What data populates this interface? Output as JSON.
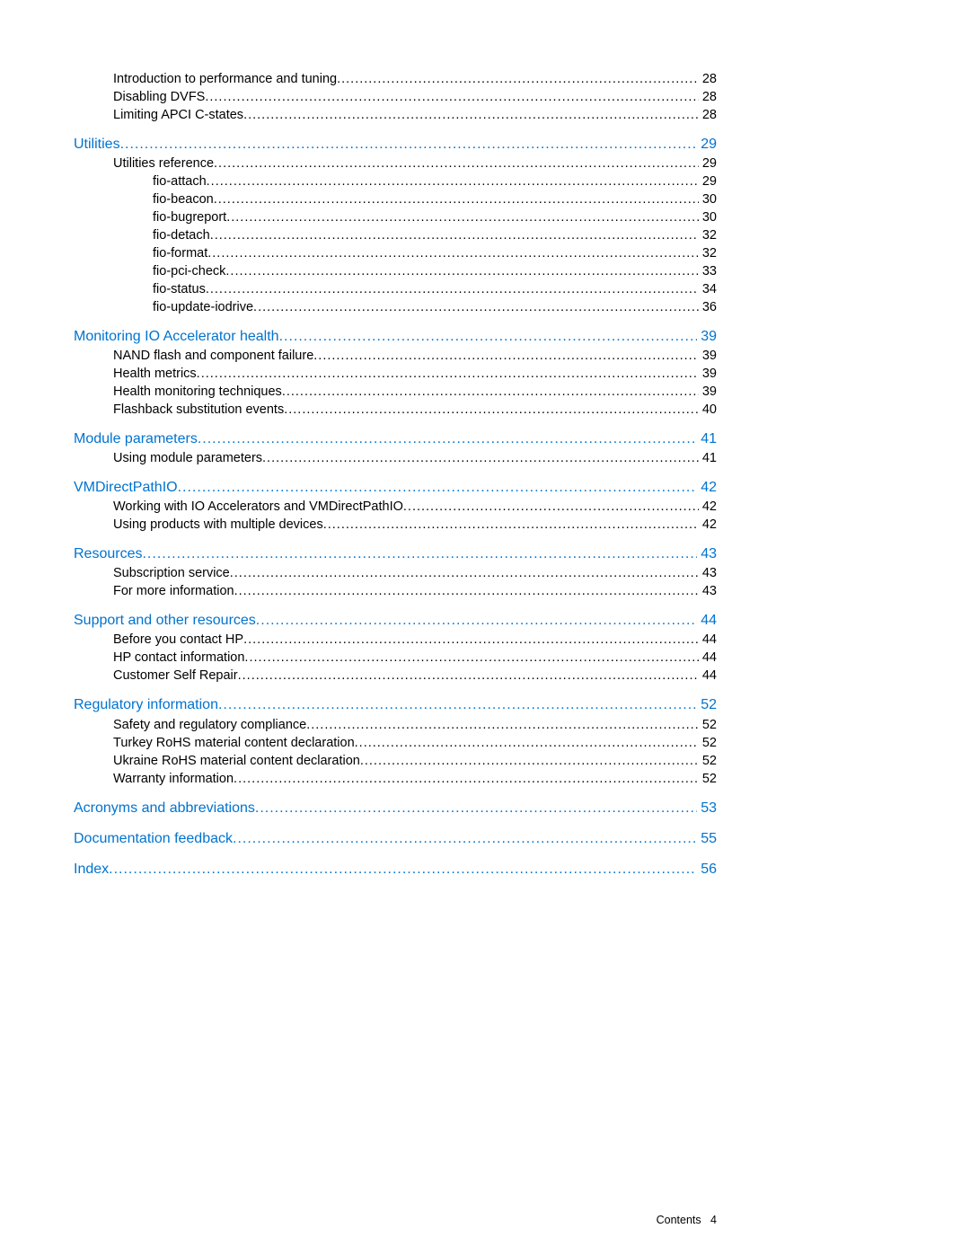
{
  "footer": {
    "label": "Contents",
    "page": "4"
  },
  "toc": [
    {
      "items": [
        {
          "level": 2,
          "label": "Introduction to performance and tuning",
          "page": "28"
        },
        {
          "level": 2,
          "label": "Disabling DVFS",
          "page": "28"
        },
        {
          "level": 2,
          "label": "Limiting APCI C-states",
          "page": "28"
        }
      ]
    },
    {
      "heading": {
        "label": "Utilities",
        "page": "29"
      },
      "items": [
        {
          "level": 2,
          "label": "Utilities reference",
          "page": "29"
        },
        {
          "level": 3,
          "label": "fio-attach",
          "page": "29"
        },
        {
          "level": 3,
          "label": "fio-beacon",
          "page": "30"
        },
        {
          "level": 3,
          "label": "fio-bugreport",
          "page": "30"
        },
        {
          "level": 3,
          "label": "fio-detach",
          "page": "32"
        },
        {
          "level": 3,
          "label": "fio-format",
          "page": "32"
        },
        {
          "level": 3,
          "label": "fio-pci-check",
          "page": "33"
        },
        {
          "level": 3,
          "label": "fio-status",
          "page": "34"
        },
        {
          "level": 3,
          "label": "fio-update-iodrive",
          "page": "36"
        }
      ]
    },
    {
      "heading": {
        "label": "Monitoring IO Accelerator health",
        "page": "39"
      },
      "items": [
        {
          "level": 2,
          "label": "NAND flash and component failure",
          "page": "39"
        },
        {
          "level": 2,
          "label": "Health metrics",
          "page": "39"
        },
        {
          "level": 2,
          "label": "Health monitoring techniques",
          "page": "39"
        },
        {
          "level": 2,
          "label": "Flashback substitution events",
          "page": "40"
        }
      ]
    },
    {
      "heading": {
        "label": "Module parameters",
        "page": "41"
      },
      "items": [
        {
          "level": 2,
          "label": "Using module parameters",
          "page": "41"
        }
      ]
    },
    {
      "heading": {
        "label": "VMDirectPathIO",
        "page": "42"
      },
      "items": [
        {
          "level": 2,
          "label": "Working with IO Accelerators and VMDirectPathIO",
          "page": "42"
        },
        {
          "level": 2,
          "label": "Using products with multiple devices",
          "page": "42"
        }
      ]
    },
    {
      "heading": {
        "label": "Resources",
        "page": "43"
      },
      "items": [
        {
          "level": 2,
          "label": "Subscription service",
          "page": "43"
        },
        {
          "level": 2,
          "label": "For more information",
          "page": "43"
        }
      ]
    },
    {
      "heading": {
        "label": "Support and other resources",
        "page": "44"
      },
      "items": [
        {
          "level": 2,
          "label": "Before you contact HP",
          "page": "44"
        },
        {
          "level": 2,
          "label": "HP contact information",
          "page": "44"
        },
        {
          "level": 2,
          "label": "Customer Self Repair",
          "page": "44"
        }
      ]
    },
    {
      "heading": {
        "label": "Regulatory information",
        "page": "52"
      },
      "items": [
        {
          "level": 2,
          "label": "Safety and regulatory compliance",
          "page": "52"
        },
        {
          "level": 2,
          "label": "Turkey RoHS material content declaration",
          "page": "52"
        },
        {
          "level": 2,
          "label": "Ukraine RoHS material content declaration",
          "page": "52"
        },
        {
          "level": 2,
          "label": "Warranty information",
          "page": "52"
        }
      ]
    },
    {
      "heading": {
        "label": "Acronyms and abbreviations",
        "page": "53"
      },
      "items": []
    },
    {
      "heading": {
        "label": "Documentation feedback",
        "page": "55"
      },
      "items": []
    },
    {
      "heading": {
        "label": "Index",
        "page": "56"
      },
      "items": []
    }
  ]
}
